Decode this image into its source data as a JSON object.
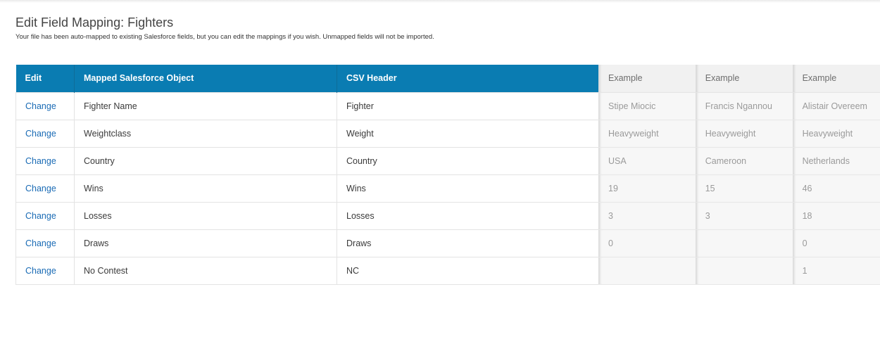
{
  "page": {
    "title": "Edit Field Mapping: Fighters",
    "subtitle": "Your file has been auto-mapped to existing Salesforce fields, but you can edit the mappings if you wish. Unmapped fields will not be imported."
  },
  "colors": {
    "header_bg": "#0a7cb2",
    "link": "#1a6bb5"
  },
  "mapping_table": {
    "headers": {
      "edit": "Edit",
      "object": "Mapped Salesforce Object",
      "csv": "CSV Header"
    },
    "rows": [
      {
        "edit": "Change",
        "object": "Fighter Name",
        "csv": "Fighter"
      },
      {
        "edit": "Change",
        "object": "Weightclass",
        "csv": "Weight"
      },
      {
        "edit": "Change",
        "object": "Country",
        "csv": "Country"
      },
      {
        "edit": "Change",
        "object": "Wins",
        "csv": "Wins"
      },
      {
        "edit": "Change",
        "object": "Losses",
        "csv": "Losses"
      },
      {
        "edit": "Change",
        "object": "Draws",
        "csv": "Draws"
      },
      {
        "edit": "Change",
        "object": "No Contest",
        "csv": "NC"
      }
    ]
  },
  "examples": {
    "headers": [
      "Example",
      "Example",
      "Example"
    ],
    "rows": [
      [
        "Stipe Miocic",
        "Francis Ngannou",
        "Alistair Overeem"
      ],
      [
        "Heavyweight",
        "Heavyweight",
        "Heavyweight"
      ],
      [
        "USA",
        "Cameroon",
        "Netherlands"
      ],
      [
        "19",
        "15",
        "46"
      ],
      [
        "3",
        "3",
        "18"
      ],
      [
        "0",
        "",
        "0"
      ],
      [
        "",
        "",
        "1"
      ]
    ]
  }
}
